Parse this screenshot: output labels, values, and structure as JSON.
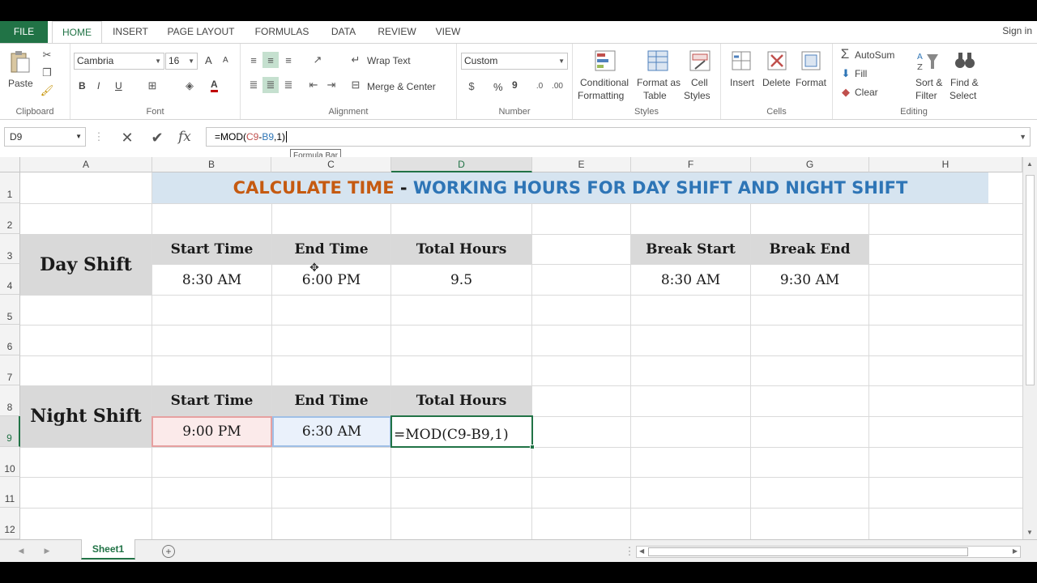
{
  "tabs": [
    "FILE",
    "HOME",
    "INSERT",
    "PAGE LAYOUT",
    "FORMULAS",
    "DATA",
    "REVIEW",
    "VIEW"
  ],
  "signin": "Sign in",
  "ribbon": {
    "clipboard": {
      "paste": "Paste",
      "label": "Clipboard"
    },
    "font": {
      "name": "Cambria",
      "size": "16",
      "bold": "B",
      "italic": "I",
      "underline": "U",
      "grow": "A",
      "shrink": "A",
      "color": "A",
      "label": "Font"
    },
    "alignment": {
      "wrap": "Wrap Text",
      "merge": "Merge & Center",
      "label": "Alignment"
    },
    "number": {
      "format": "Custom",
      "percent": "%",
      "comma": "9",
      "label": "Number"
    },
    "styles": {
      "conditional1": "Conditional",
      "conditional2": "Formatting",
      "table1": "Format as",
      "table2": "Table",
      "cell1": "Cell",
      "cell2": "Styles",
      "label": "Styles"
    },
    "cells": {
      "insert": "Insert",
      "delete": "Delete",
      "format": "Format",
      "label": "Cells"
    },
    "editing": {
      "autosum": "AutoSum",
      "fill": "Fill",
      "clear": "Clear",
      "sort1": "Sort &",
      "sort2": "Filter",
      "find1": "Find &",
      "find2": "Select",
      "label": "Editing"
    }
  },
  "formula_bar": {
    "name_box": "D9",
    "fx": "fx",
    "formula_pre": "=MOD(",
    "formula_c": "C9",
    "formula_mid": "-",
    "formula_b": "B9",
    "formula_post": ",1)",
    "tooltip": "Formula Bar"
  },
  "columns": [
    "A",
    "B",
    "C",
    "D",
    "E",
    "F",
    "G",
    "H"
  ],
  "rows": [
    "1",
    "2",
    "3",
    "4",
    "5",
    "6",
    "7",
    "8",
    "9",
    "10",
    "11",
    "12"
  ],
  "sheet": {
    "title_orange": "CALCULATE TIME",
    "title_dash": " - ",
    "title_blue": "WORKING HOURS FOR DAY SHIFT AND NIGHT SHIFT",
    "day_shift": "Day Shift",
    "night_shift": "Night Shift",
    "start_time": "Start Time",
    "end_time": "End Time",
    "total_hours": "Total Hours",
    "break_start": "Break Start",
    "break_end": "Break End",
    "day_start": "8:30 AM",
    "day_end": "6:00 PM",
    "day_total": "9.5",
    "break_start_val": "8:30 AM",
    "break_end_val": "9:30 AM",
    "night_start": "9:00 PM",
    "night_end": "6:30 AM",
    "night_total_formula": "=MOD(C9-B9,1)"
  },
  "sheet_tab": "Sheet1"
}
